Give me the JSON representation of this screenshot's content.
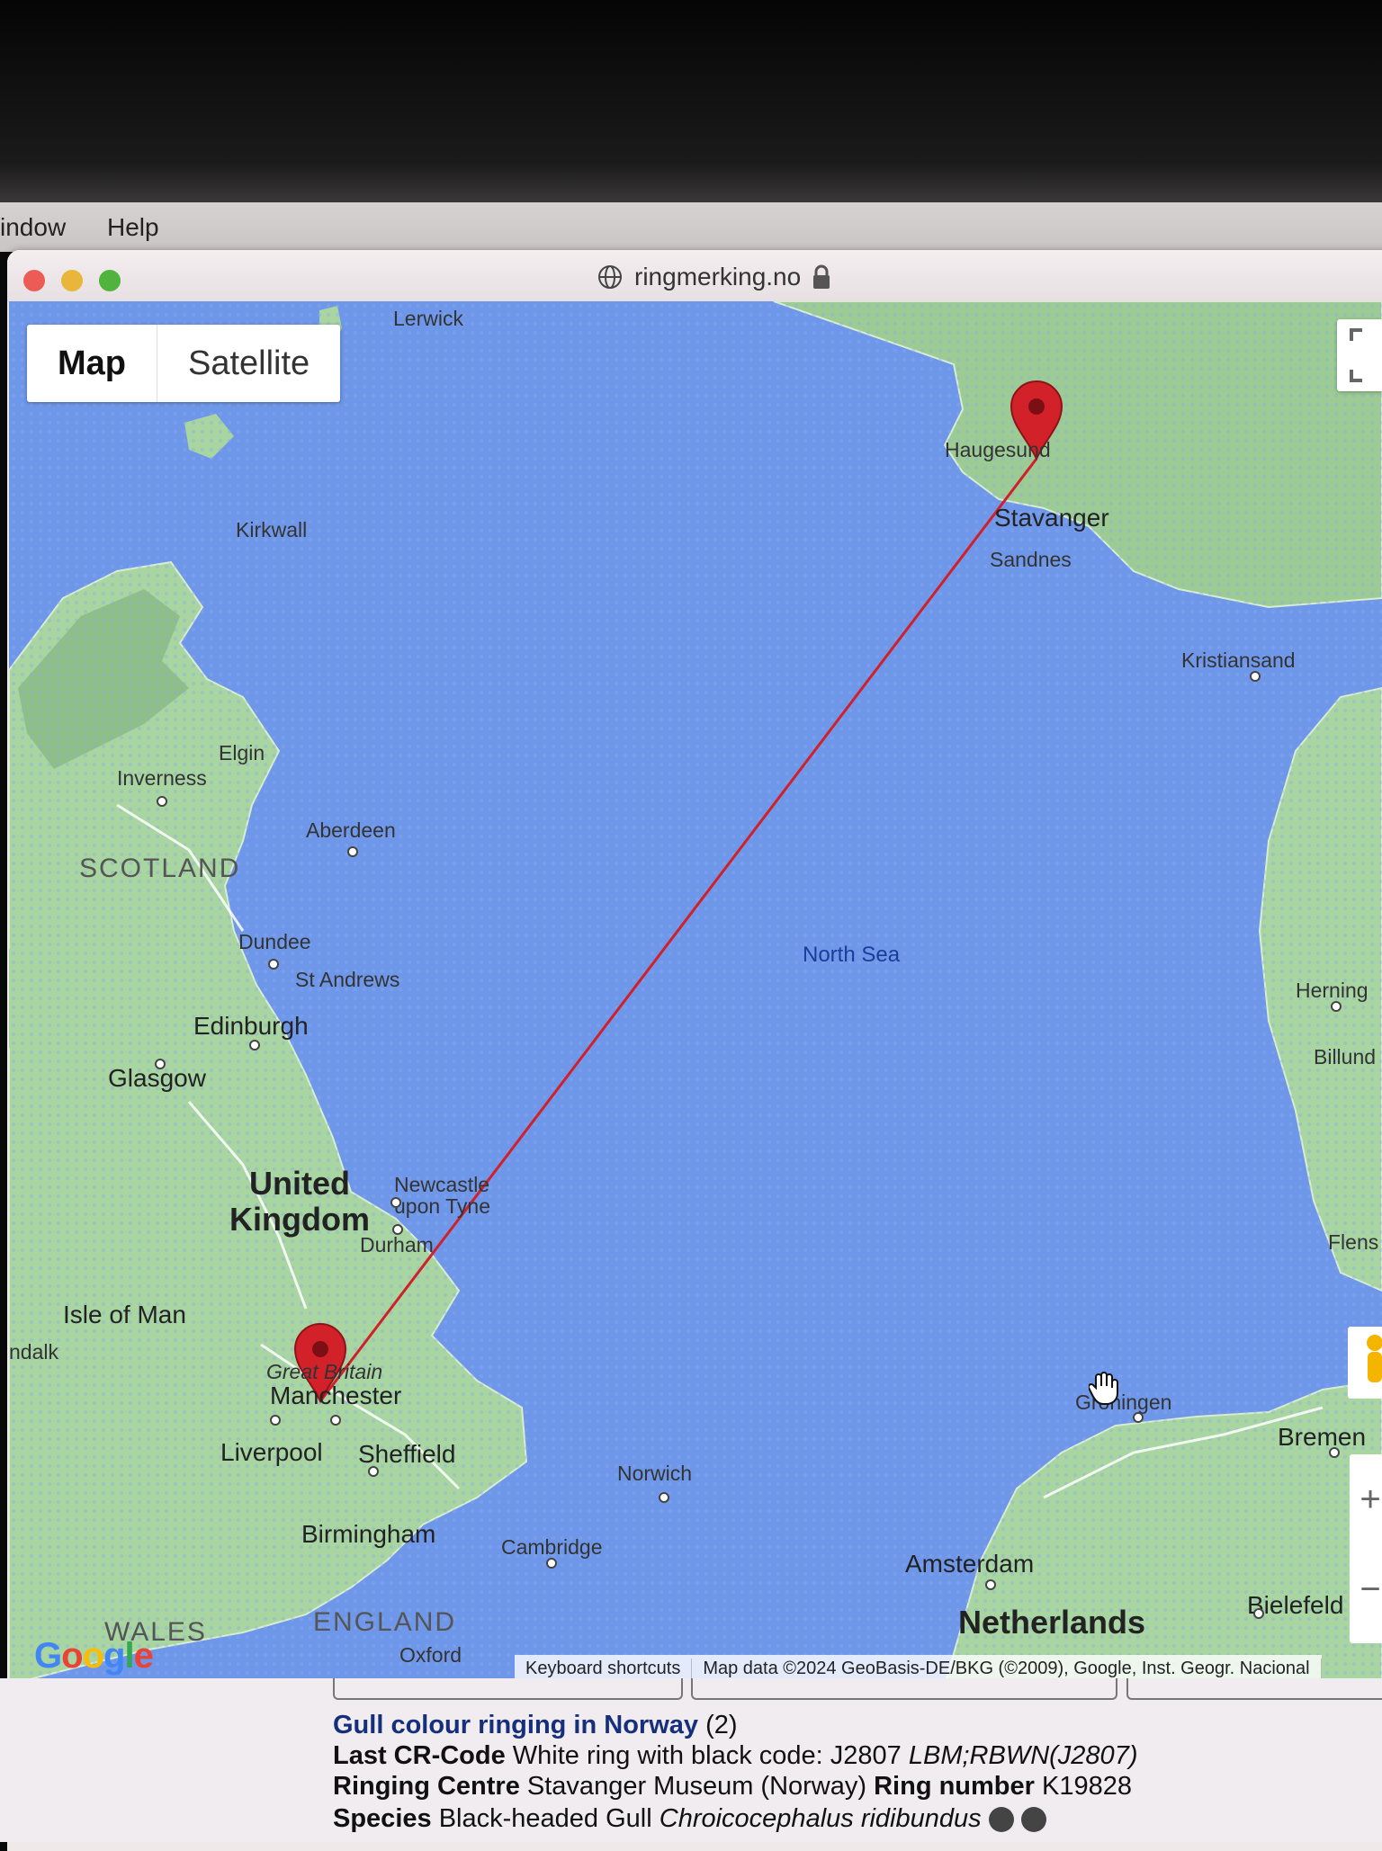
{
  "menubar": {
    "window_label": "indow",
    "help_label": "Help"
  },
  "browser": {
    "url": "ringmerking.no"
  },
  "map": {
    "type_buttons": {
      "map": "Map",
      "satellite": "Satellite"
    },
    "sea_label": "North Sea",
    "country_labels": {
      "scotland": "SCOTLAND",
      "uk_line1": "United",
      "uk_line2": "Kingdom",
      "england": "ENGLAND",
      "wales": "WALES",
      "netherlands": "Netherlands",
      "great_britain": "Great Britain",
      "isle_of_man": "Isle of Man"
    },
    "places": {
      "lerwick": "Lerwick",
      "kirkwall": "Kirkwall",
      "elgin": "Elgin",
      "inverness": "Inverness",
      "aberdeen": "Aberdeen",
      "dundee": "Dundee",
      "st_andrews": "St Andrews",
      "edinburgh": "Edinburgh",
      "glasgow": "Glasgow",
      "newcastle_1": "Newcastle",
      "newcastle_2": "upon Tyne",
      "durham": "Durham",
      "manchester": "Manchester",
      "liverpool": "Liverpool",
      "sheffield": "Sheffield",
      "birmingham": "Birmingham",
      "norwich": "Norwich",
      "cambridge": "Cambridge",
      "oxford": "Oxford",
      "haugesund": "Haugesund",
      "stavanger": "Stavanger",
      "sandnes": "Sandnes",
      "kristiansand": "Kristiansand",
      "herning": "Herning",
      "billund": "Billund",
      "flens": "Flens",
      "groningen": "Groningen",
      "bremen": "Bremen",
      "amsterdam": "Amsterdam",
      "bielefeld": "Bielefeld",
      "ndalk": "ndalk"
    },
    "attribution": {
      "shortcuts": "Keyboard shortcuts",
      "data": "Map data ©2024 GeoBasis-DE/BKG (©2009), Google, Inst. Geogr. Nacional"
    },
    "logo": "Google",
    "route_color": "#d0202a",
    "sea_color": "#6f97e9",
    "land_color": "#a8d5a0"
  },
  "info": {
    "heading": "Gull colour ringing in Norway",
    "heading_count": "(2)",
    "cr_label": "Last CR-Code",
    "cr_value": "White ring with black code: J2807",
    "cr_code": "LBM;RBWN(J2807)",
    "centre_label": "Ringing Centre",
    "centre_value": "Stavanger Museum (Norway)",
    "ring_label": "Ring number",
    "ring_value": "K19828",
    "species_label": "Species",
    "species_value": "Black-headed Gull",
    "species_latin": "Chroicocephalus ridibundus"
  }
}
